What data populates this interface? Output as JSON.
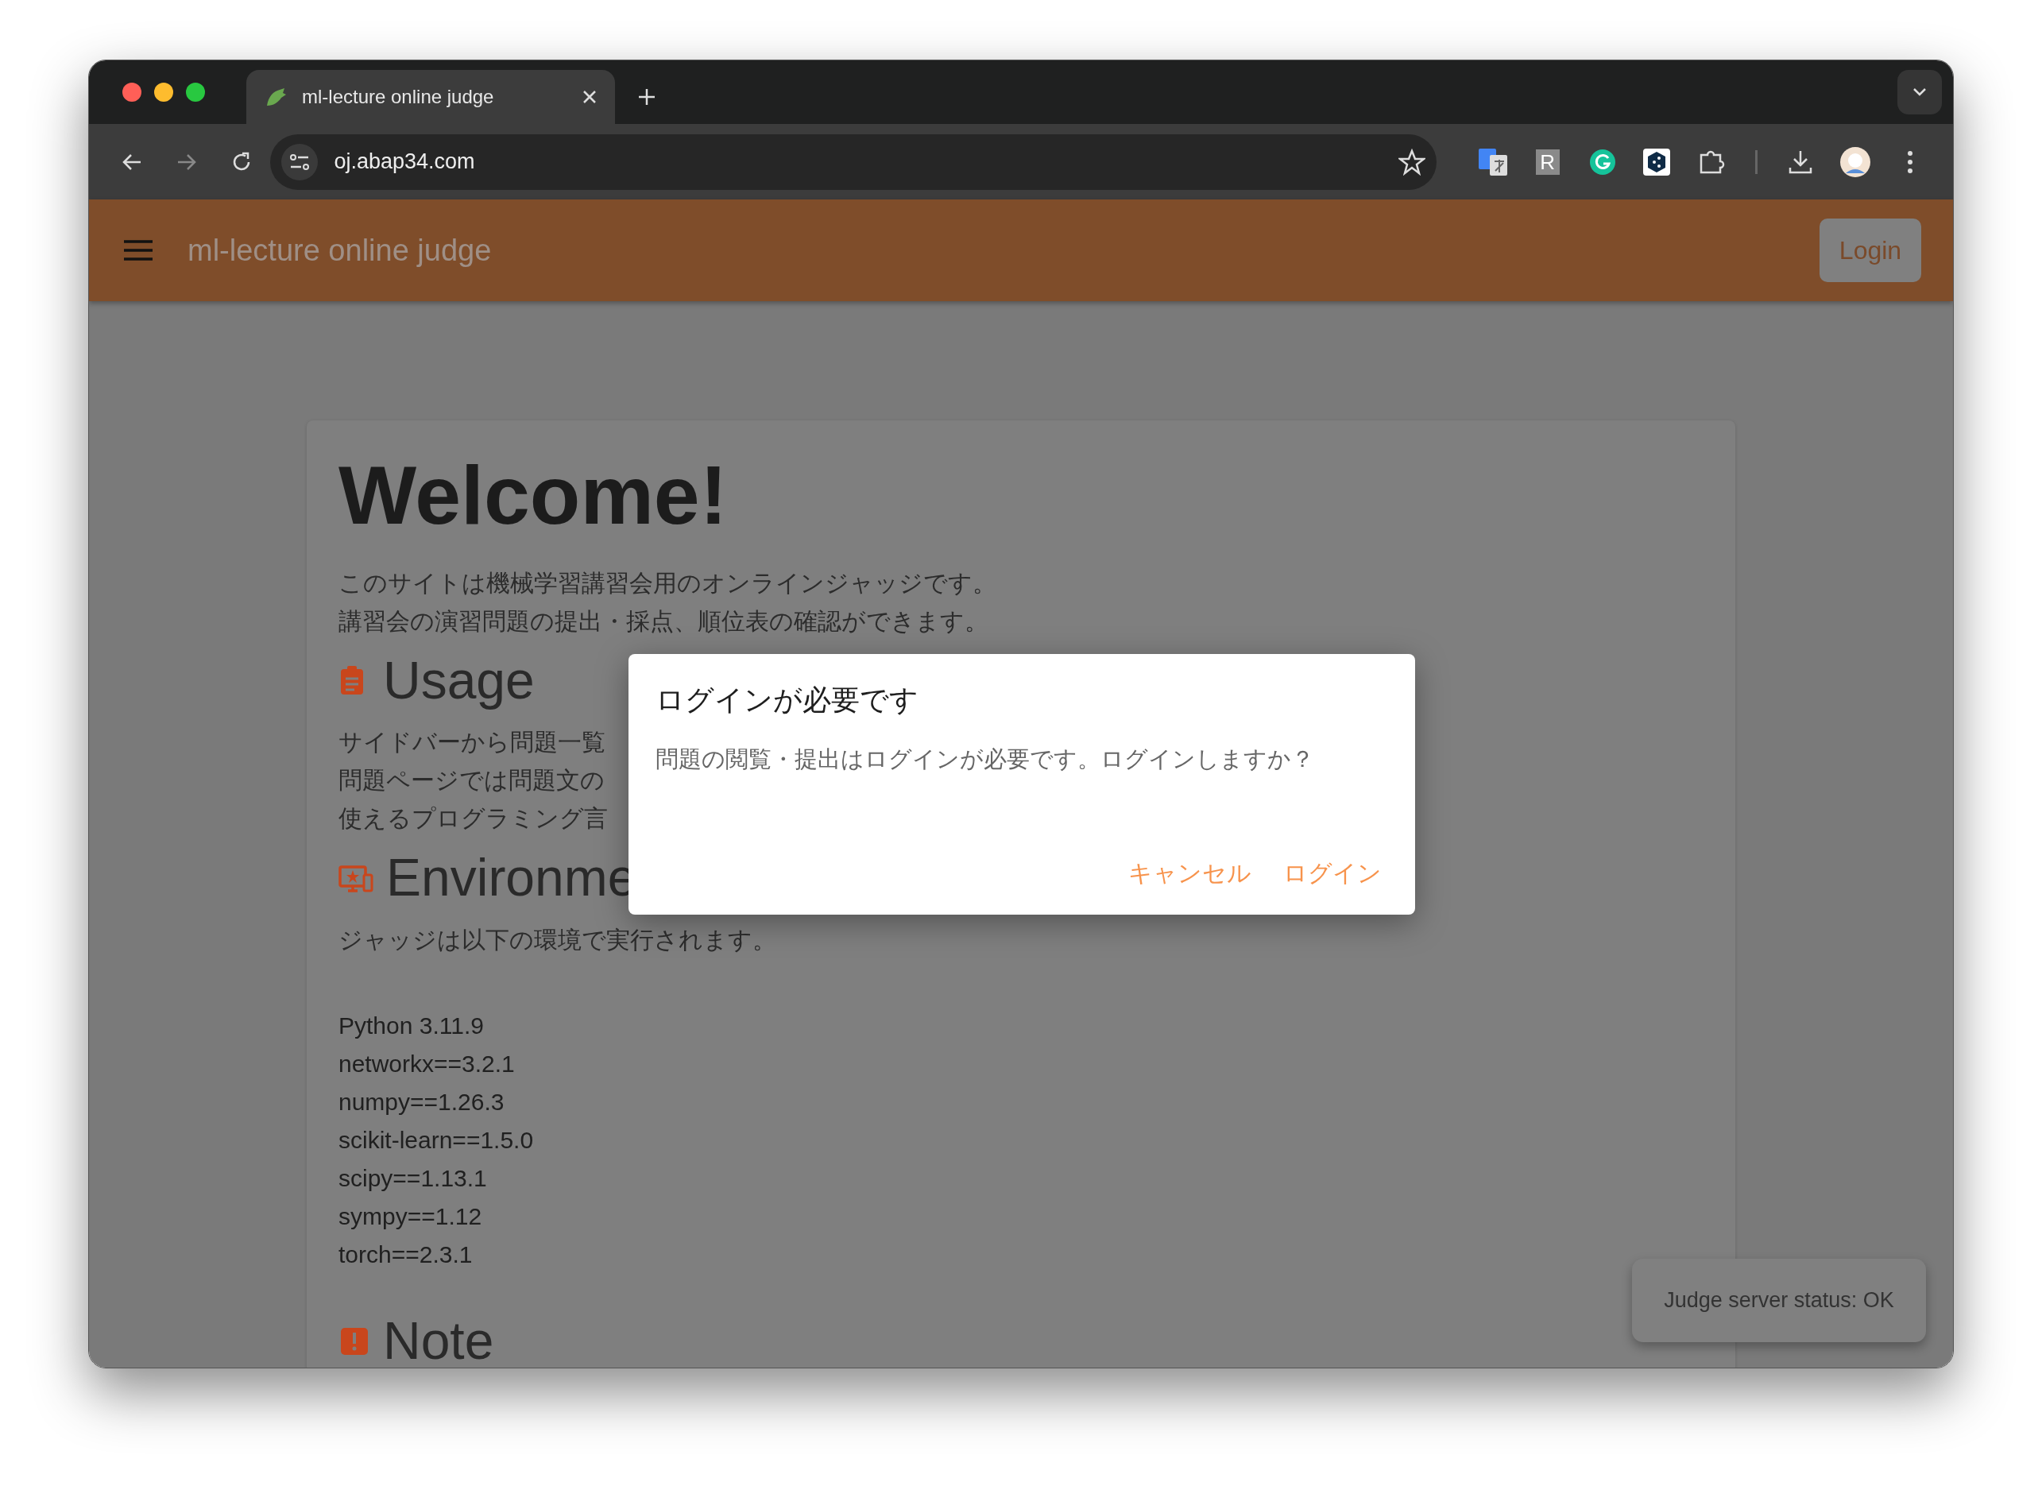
{
  "browser": {
    "tabs": [
      {
        "title": "ml-lecture online judge",
        "selected": true
      }
    ],
    "address": "oj.abap34.com",
    "extensions": [
      {
        "kind": "translate"
      },
      {
        "kind": "letter",
        "label": "R"
      },
      {
        "kind": "grammar"
      },
      {
        "kind": "hexagon"
      },
      {
        "kind": "puzzle"
      }
    ]
  },
  "app_bar": {
    "title": "ml-lecture online judge",
    "login_button": "Login"
  },
  "welcome": {
    "title": "Welcome!",
    "intro": [
      "このサイトは機械学習講習会用のオンラインジャッジです。",
      "講習会の演習問題の提出・採点、順位表の確認ができます。"
    ]
  },
  "sections": [
    {
      "kind": "usage",
      "heading": "Usage",
      "lines": [
        "サイドバーから問題一覧",
        "問題ページでは問題文の",
        "使えるプログラミング言"
      ]
    },
    {
      "kind": "environment",
      "heading": "Environme",
      "lines": [
        "ジャッジは以下の環境で実行されます。"
      ],
      "packages": [
        "Python 3.11.9",
        "networkx==3.2.1",
        "numpy==1.26.3",
        "scikit-learn==1.5.0",
        "scipy==1.13.1",
        "sympy==1.12",
        "torch==2.3.1"
      ]
    },
    {
      "kind": "note",
      "heading": "Note"
    }
  ],
  "dialog": {
    "title": "ログインが必要です",
    "message": "問題の閲覧・提出はログインが必要です。ログインしますか？",
    "buttons": [
      "キャンセル",
      "ログイン"
    ]
  },
  "status_toast": "Judge server status: OK"
}
